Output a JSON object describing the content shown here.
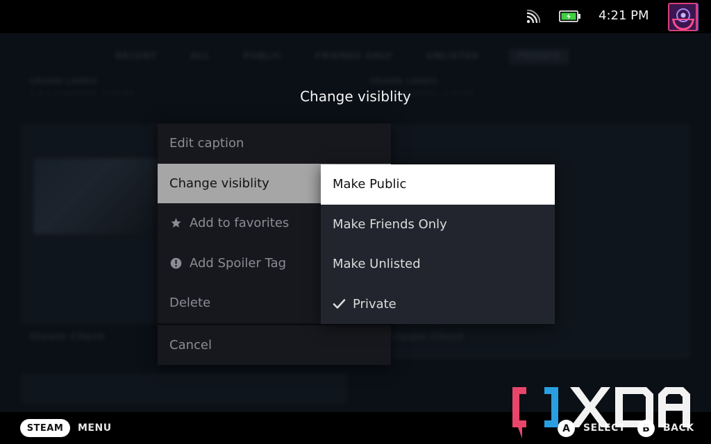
{
  "status_bar": {
    "time": "4:21 PM",
    "icons": [
      "wifi-icon",
      "battery-charging-icon",
      "avatar"
    ]
  },
  "background": {
    "tabs": [
      {
        "label": "RECENT"
      },
      {
        "label": "ALL"
      },
      {
        "label": "PUBLIC"
      },
      {
        "label": "FRIENDS ONLY"
      },
      {
        "label": "UNLISTED"
      },
      {
        "label": "PRIVATE"
      }
    ],
    "left_heading": "GRAND LANDS",
    "left_sub": "1 of 1 screenshot  ·  2:35 PM",
    "right_heading": "GRAND LANDS",
    "right_sub": "1 of 1 screenshot  ·  2:35 PM",
    "left_card_title": "Steam Client",
    "right_card_title": "Steam Client"
  },
  "dialog": {
    "title": "Change visiblity"
  },
  "context_menu": {
    "items": [
      {
        "label": "Edit caption",
        "icon": null,
        "selected": false
      },
      {
        "label": "Change visiblity",
        "icon": null,
        "selected": true
      },
      {
        "label": "Add to favorites",
        "icon": "star-icon",
        "selected": false
      },
      {
        "label": "Add Spoiler Tag",
        "icon": "exclamation-circle-icon",
        "selected": false
      },
      {
        "label": "Delete",
        "icon": null,
        "selected": false
      }
    ],
    "cancel_label": "Cancel"
  },
  "visibility_submenu": {
    "items": [
      {
        "label": "Make Public",
        "focused": true,
        "checked": false
      },
      {
        "label": "Make Friends Only",
        "focused": false,
        "checked": false
      },
      {
        "label": "Make Unlisted",
        "focused": false,
        "checked": false
      },
      {
        "label": "Private",
        "focused": false,
        "checked": true
      }
    ]
  },
  "bottom_bar": {
    "steam_label": "STEAM",
    "menu_label": "MENU",
    "a_button": "A",
    "select_label": "SELECT",
    "b_button": "B",
    "back_label": "BACK"
  },
  "watermark": {
    "text": "XDA",
    "colors": {
      "left_bracket": "#e8456b",
      "right_bracket": "#2a9fe0",
      "text": "#ffffff"
    }
  }
}
